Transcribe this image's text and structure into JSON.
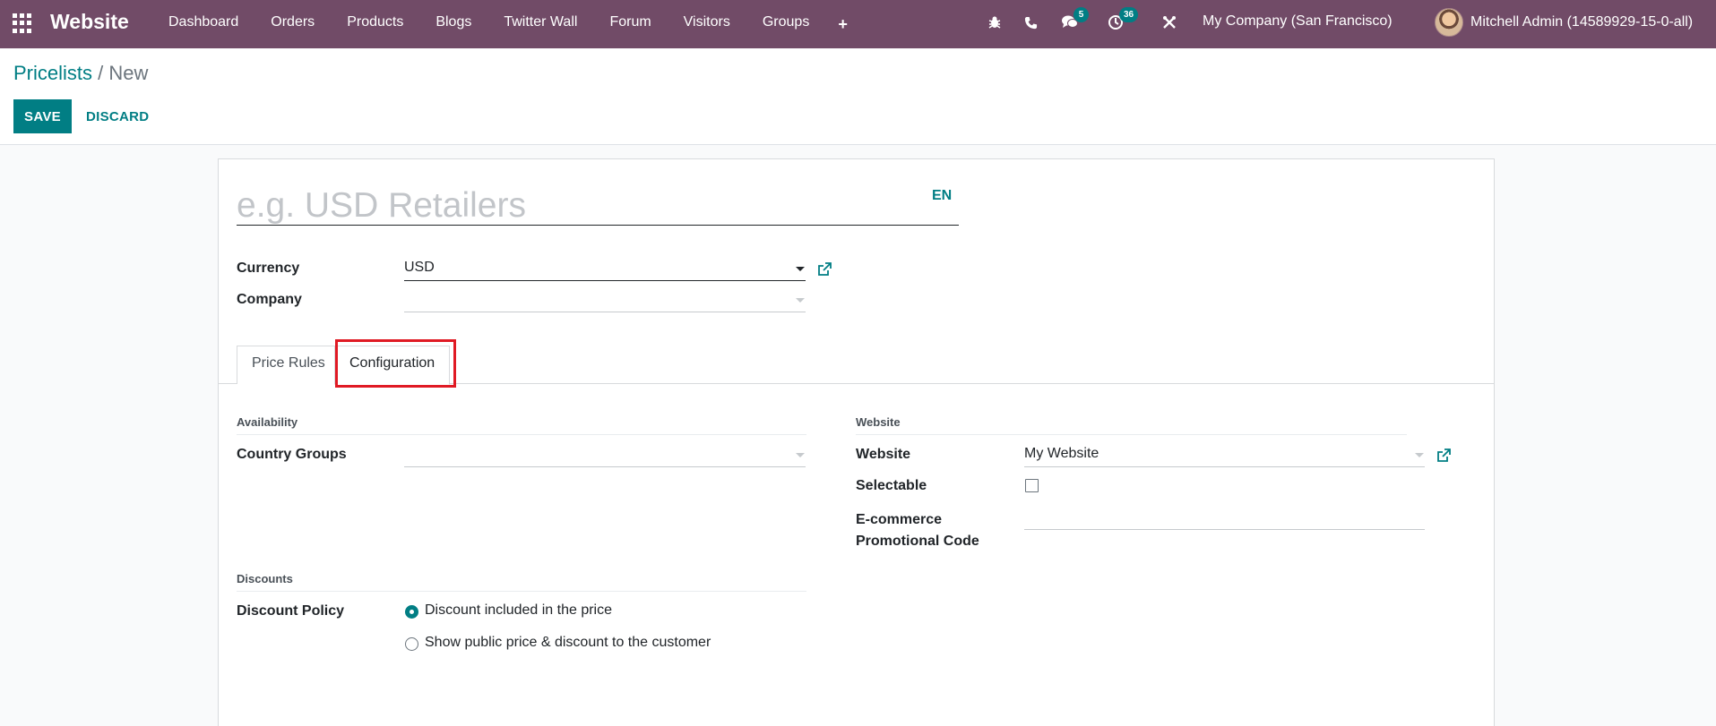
{
  "navbar": {
    "app_name": "Website",
    "menu": [
      "Dashboard",
      "Orders",
      "Products",
      "Blogs",
      "Twitter Wall",
      "Forum",
      "Visitors",
      "Groups"
    ],
    "add_icon": "+",
    "messages_badge": "5",
    "activities_badge": "36",
    "company": "My Company (San Francisco)",
    "user": "Mitchell Admin (14589929-15-0-all)",
    "accent": "#714b67"
  },
  "control_panel": {
    "breadcrumb_parent": "Pricelists",
    "breadcrumb_separator": "/",
    "breadcrumb_current": "New",
    "save_label": "SAVE",
    "discard_label": "DISCARD"
  },
  "form": {
    "name_placeholder": "e.g. USD Retailers",
    "lang": "EN",
    "currency_label": "Currency",
    "currency_value": "USD",
    "company_label": "Company",
    "company_value": "",
    "tabs": [
      "Price Rules",
      "Configuration"
    ],
    "active_tab": "Configuration",
    "availability": {
      "title": "Availability",
      "country_groups_label": "Country Groups",
      "country_groups_value": ""
    },
    "website_section": {
      "title": "Website",
      "website_label": "Website",
      "website_value": "My Website",
      "selectable_label": "Selectable",
      "selectable_checked": false,
      "promo_label_line1": "E-commerce",
      "promo_label_line2": "Promotional Code",
      "promo_value": ""
    },
    "discounts": {
      "title": "Discounts",
      "policy_label": "Discount Policy",
      "options": [
        "Discount included in the price",
        "Show public price & discount to the customer"
      ],
      "selected_index": 0
    }
  },
  "colors": {
    "primary": "#017e84",
    "highlight_box": "#e01a24"
  }
}
